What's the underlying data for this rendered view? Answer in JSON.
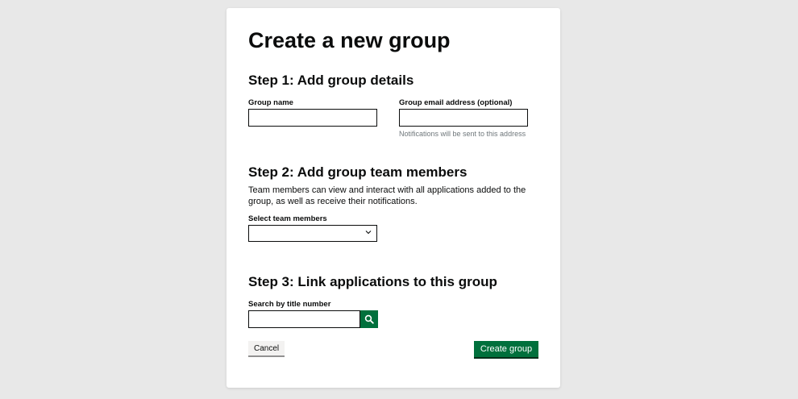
{
  "page": {
    "title": "Create a new group"
  },
  "step1": {
    "heading": "Step 1: Add group details",
    "group_name_label": "Group name",
    "group_name_value": "",
    "email_label": "Group email address (optional)",
    "email_value": "",
    "email_hint": "Notifications will be sent to this address"
  },
  "step2": {
    "heading": "Step 2: Add group team members",
    "description": "Team members can view and interact with all applications added to the group, as well as receive their notifications.",
    "select_label": "Select team members",
    "select_value": ""
  },
  "step3": {
    "heading": "Step 3: Link applications to this group",
    "search_label": "Search by title number",
    "search_value": ""
  },
  "actions": {
    "cancel_label": "Cancel",
    "create_label": "Create group"
  },
  "colors": {
    "primary_green": "#00703c",
    "background": "#e8e8e8",
    "card": "#ffffff",
    "text": "#0b0c0c",
    "hint": "#6f777b"
  },
  "icons": {
    "select_arrow": "chevron-down-icon",
    "search": "search-icon"
  }
}
